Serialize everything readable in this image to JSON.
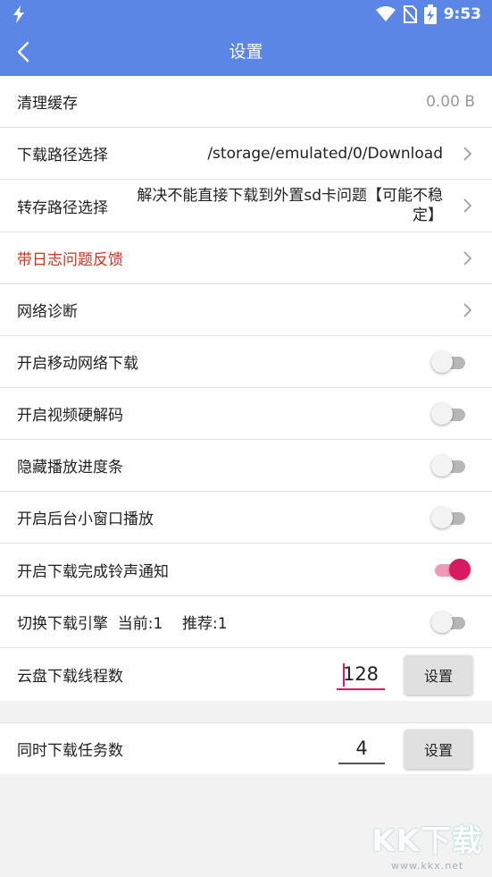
{
  "status_bar": {
    "time": "9:53"
  },
  "toolbar": {
    "title": "设置"
  },
  "rows": {
    "clear_cache": {
      "label": "清理缓存",
      "value": "0.00 B"
    },
    "download_path": {
      "label": "下载路径选择",
      "value": "/storage/emulated/0/Download"
    },
    "transfer_path": {
      "label": "转存路径选择",
      "value": "解决不能直接下载到外置sd卡问题【可能不稳定】"
    },
    "feedback": {
      "label": "带日志问题反馈"
    },
    "network_diag": {
      "label": "网络诊断"
    },
    "mobile_download": {
      "label": "开启移动网络下载",
      "on": false
    },
    "hw_decode": {
      "label": "开启视频硬解码",
      "on": false
    },
    "hide_progress": {
      "label": "隐藏播放进度条",
      "on": false
    },
    "bg_window": {
      "label": "开启后台小窗口播放",
      "on": false
    },
    "ring_notify": {
      "label": "开启下载完成铃声通知",
      "on": true
    },
    "engine": {
      "label": "切换下载引擎  当前:1    推荐:1",
      "on": false
    },
    "cloud_threads": {
      "label": "云盘下载线程数",
      "value": "128",
      "button": "设置"
    },
    "concurrent_tasks": {
      "label": "同时下载任务数",
      "value": "4",
      "button": "设置"
    }
  },
  "watermark": {
    "big": "KK下载",
    "small": "www.kkx.net"
  },
  "colors": {
    "accent": "#5b86e5",
    "toggle_on": "#d81b60",
    "feedback_text": "#d4321e"
  }
}
